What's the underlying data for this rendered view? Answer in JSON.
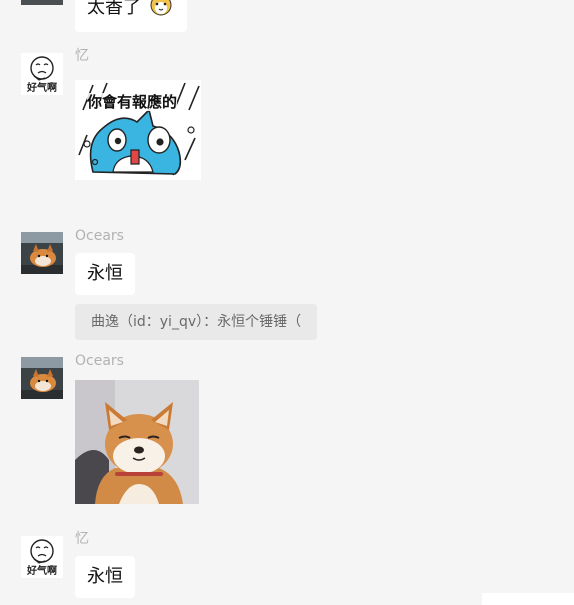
{
  "colors": {
    "background": "#f5f5f5",
    "bubble": "#ffffff",
    "quote_background": "#e9e9e9",
    "sender_name": "#b2b2b2",
    "sticker_fish": "#3ab4e0"
  },
  "messages": [
    {
      "type": "text",
      "text": "太香了",
      "emoji": "shiba-emoji"
    },
    {
      "type": "sticker",
      "sender": "忆",
      "avatar_caption": "好气啊",
      "sticker_text": "你會有報應的",
      "sticker": "blue-fish-rain-sticker"
    },
    {
      "type": "text",
      "sender": "Ocears",
      "text": "永恒",
      "avatar": "shiba-car-avatar"
    },
    {
      "type": "quote",
      "text": "曲逸（id：yi_qv）：永恒个锤锤（"
    },
    {
      "type": "image",
      "sender": "Ocears",
      "image": "shiba-squint-photo"
    },
    {
      "type": "text",
      "sender": "忆",
      "avatar_caption": "好气啊",
      "text": "永恒"
    }
  ]
}
